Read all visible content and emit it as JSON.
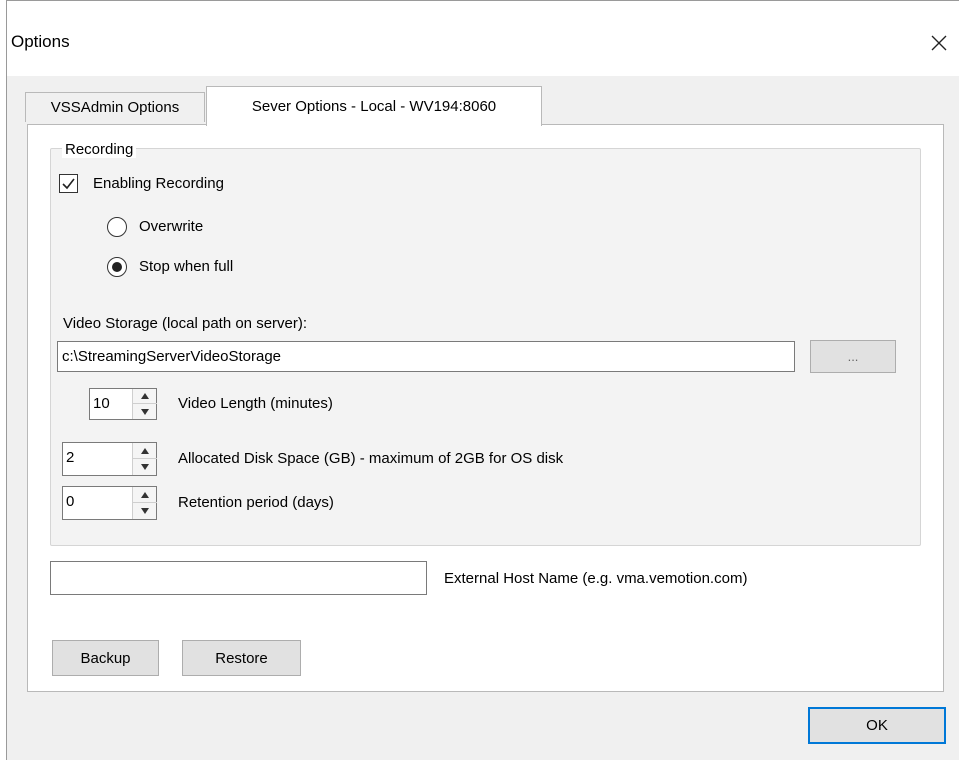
{
  "window": {
    "title": "Options"
  },
  "tabs": [
    {
      "label": "VSSAdmin Options"
    },
    {
      "label": "Sever Options - Local - WV194:8060"
    }
  ],
  "recording": {
    "group_label": "Recording",
    "enable_label": "Enabling Recording",
    "enabled": true,
    "overwrite_label": "Overwrite",
    "stop_when_full_label": "Stop when full",
    "selected_mode": "Stop when full"
  },
  "storage": {
    "label": "Video Storage (local path on server):",
    "path": "c:\\StreamingServerVideoStorage",
    "browse_label": "..."
  },
  "video_length": {
    "value": "10",
    "label": "Video Length (minutes)"
  },
  "disk_space": {
    "value": "2",
    "label": "Allocated Disk Space (GB)  - maximum of 2GB for OS disk"
  },
  "retention": {
    "value": "0",
    "label": "Retention period (days)"
  },
  "external_host": {
    "value": "",
    "label": "External Host Name (e.g. vma.vemotion.com)"
  },
  "buttons": {
    "backup": "Backup",
    "restore": "Restore",
    "ok": "OK"
  },
  "colors": {
    "accent": "#0078d7",
    "panel": "#f0f0f0"
  }
}
